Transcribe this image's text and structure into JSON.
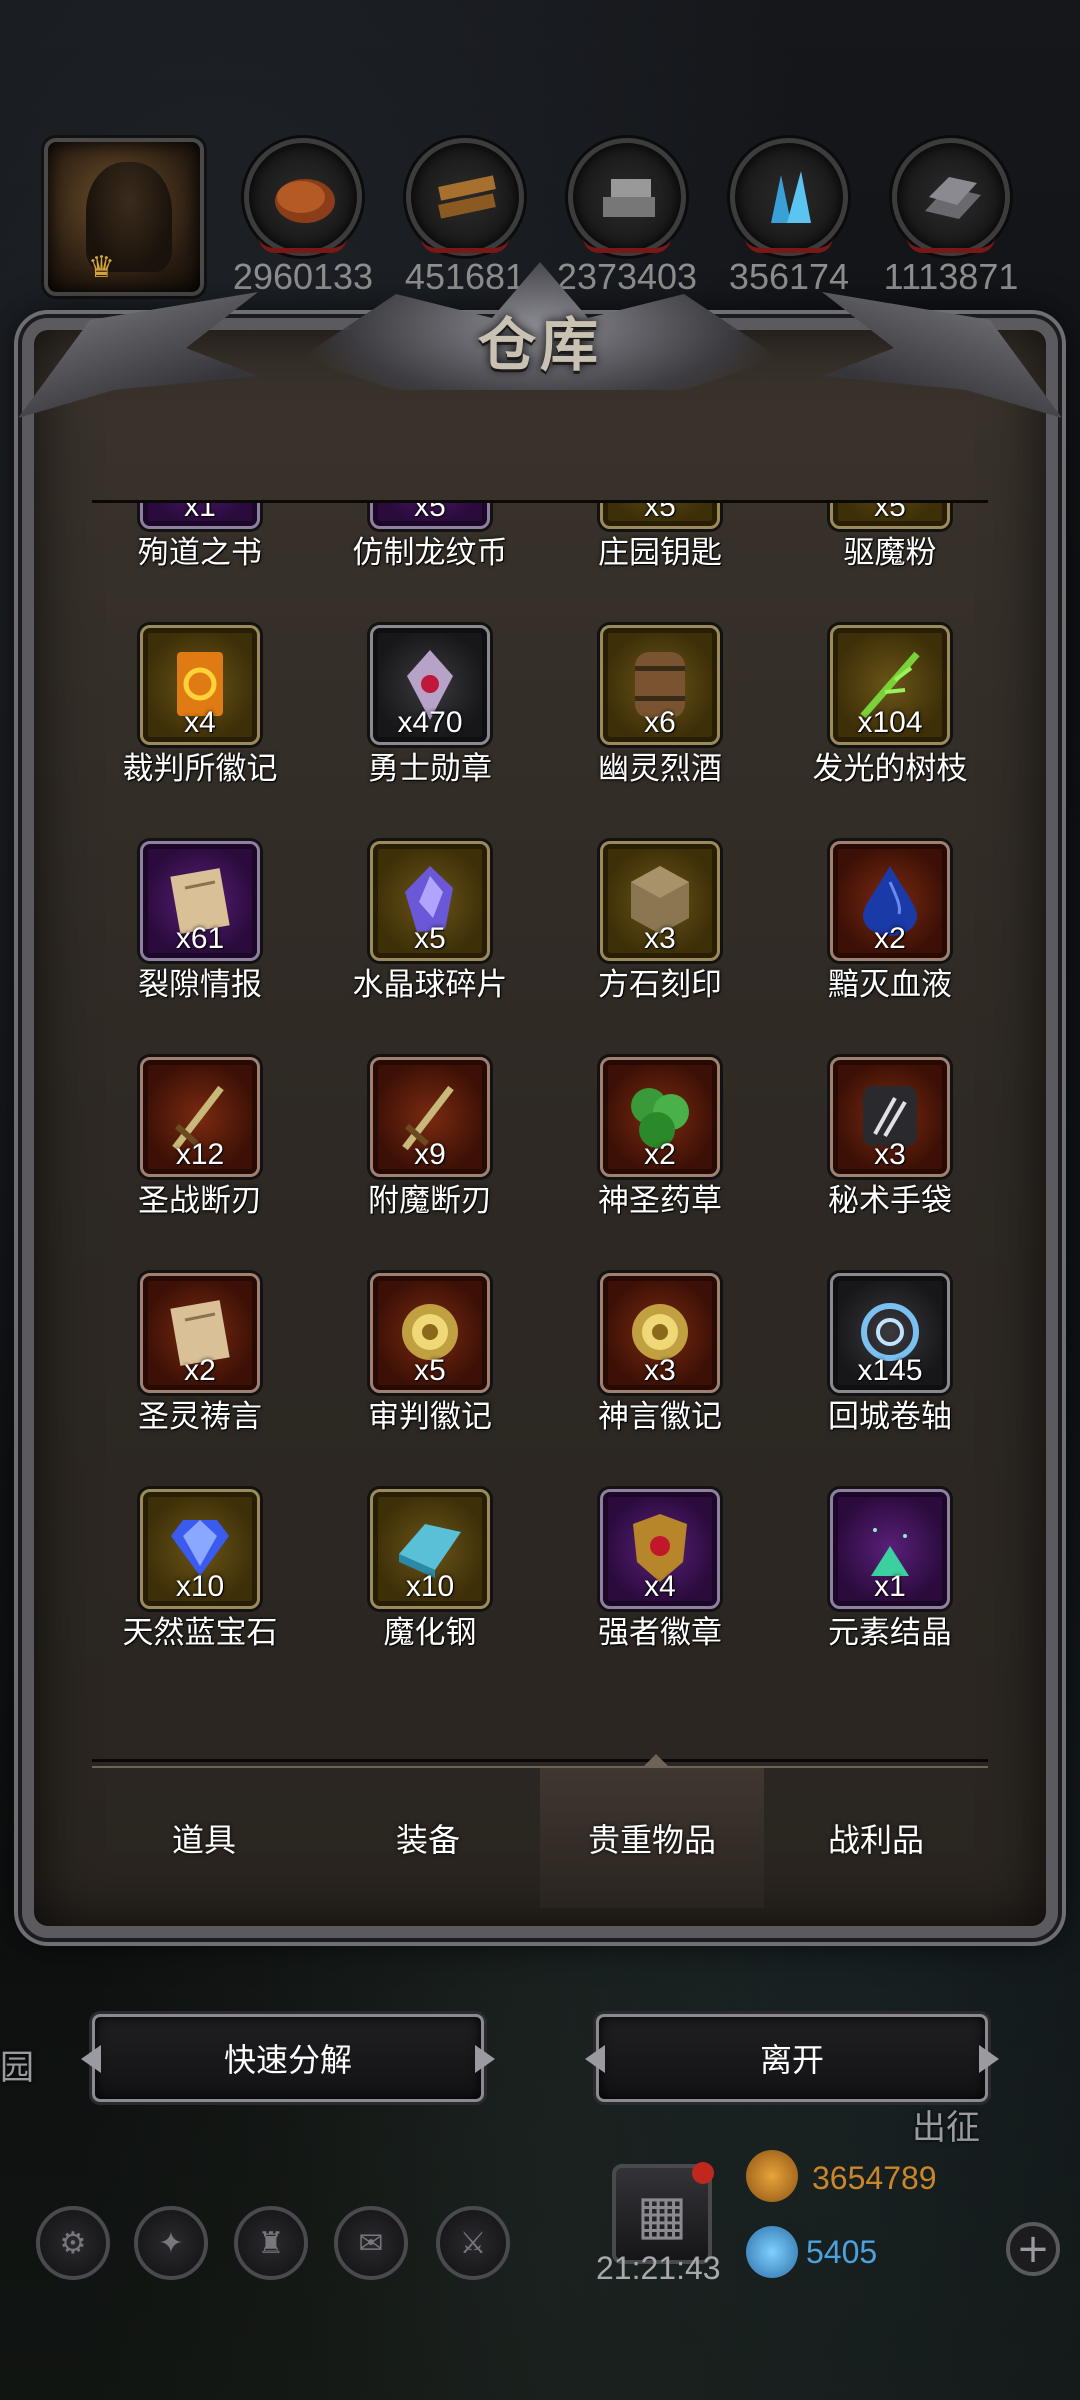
{
  "title": "仓库",
  "resources": [
    {
      "icon": "bread-icon",
      "value": "2960133"
    },
    {
      "icon": "wood-icon",
      "value": "451681"
    },
    {
      "icon": "stone-icon",
      "value": "2373403"
    },
    {
      "icon": "crystal-icon",
      "value": "356174"
    },
    {
      "icon": "iron-icon",
      "value": "1113871"
    }
  ],
  "items": [
    {
      "name": "殉道之书",
      "count": "x1",
      "rarity": "purple",
      "icon": "book-icon"
    },
    {
      "name": "仿制龙纹币",
      "count": "x5",
      "rarity": "purple",
      "icon": "coin-icon"
    },
    {
      "name": "庄园钥匙",
      "count": "x5",
      "rarity": "gold",
      "icon": "key-icon"
    },
    {
      "name": "驱魔粉",
      "count": "x5",
      "rarity": "gold",
      "icon": "powder-icon"
    },
    {
      "name": "裁判所徽记",
      "count": "x4",
      "rarity": "gold",
      "icon": "sigil-card-icon"
    },
    {
      "name": "勇士勋章",
      "count": "x470",
      "rarity": "grey",
      "icon": "medal-icon"
    },
    {
      "name": "幽灵烈酒",
      "count": "x6",
      "rarity": "gold",
      "icon": "barrel-icon"
    },
    {
      "name": "发光的树枝",
      "count": "x104",
      "rarity": "gold",
      "icon": "branch-icon"
    },
    {
      "name": "裂隙情报",
      "count": "x61",
      "rarity": "purple",
      "icon": "scroll-icon"
    },
    {
      "name": "水晶球碎片",
      "count": "x5",
      "rarity": "gold",
      "icon": "crystal-shard-icon"
    },
    {
      "name": "方石刻印",
      "count": "x3",
      "rarity": "gold",
      "icon": "stone-block-icon"
    },
    {
      "name": "黯灭血液",
      "count": "x2",
      "rarity": "red",
      "icon": "blood-drop-icon"
    },
    {
      "name": "圣战断刃",
      "count": "x12",
      "rarity": "red",
      "icon": "broken-sword-icon"
    },
    {
      "name": "附魔断刃",
      "count": "x9",
      "rarity": "red",
      "icon": "broken-sword-icon"
    },
    {
      "name": "神圣药草",
      "count": "x2",
      "rarity": "red",
      "icon": "herb-icon"
    },
    {
      "name": "秘术手袋",
      "count": "x3",
      "rarity": "red",
      "icon": "pouch-icon"
    },
    {
      "name": "圣灵祷言",
      "count": "x2",
      "rarity": "red",
      "icon": "scroll-icon"
    },
    {
      "name": "审判徽记",
      "count": "x5",
      "rarity": "red",
      "icon": "emblem-icon"
    },
    {
      "name": "神言徽记",
      "count": "x3",
      "rarity": "red",
      "icon": "emblem-icon"
    },
    {
      "name": "回城卷轴",
      "count": "x145",
      "rarity": "grey",
      "icon": "portal-scroll-icon"
    },
    {
      "name": "天然蓝宝石",
      "count": "x10",
      "rarity": "gold",
      "icon": "sapphire-icon"
    },
    {
      "name": "魔化钢",
      "count": "x10",
      "rarity": "gold",
      "icon": "steel-ingot-icon"
    },
    {
      "name": "强者徽章",
      "count": "x4",
      "rarity": "purple",
      "icon": "badge-icon"
    },
    {
      "name": "元素结晶",
      "count": "x1",
      "rarity": "purple",
      "icon": "element-crystal-icon"
    }
  ],
  "tabs": [
    {
      "label": "道具"
    },
    {
      "label": "装备"
    },
    {
      "label": "贵重物品",
      "active": true
    },
    {
      "label": "战利品"
    }
  ],
  "buttons": {
    "dismantle": "快速分解",
    "leave": "离开"
  },
  "hud": {
    "left_label": "园",
    "expedition": "出征",
    "clock": "21:21:43",
    "gold": "3654789",
    "gems": "5405"
  },
  "colors": {
    "gold_text": "#c9862a",
    "gem_text": "#4aa3e0",
    "rarity_gold": "#6a5418",
    "rarity_purple": "#5a1f7a",
    "rarity_red": "#7a2a10",
    "rarity_grey": "#3a3a3e"
  }
}
